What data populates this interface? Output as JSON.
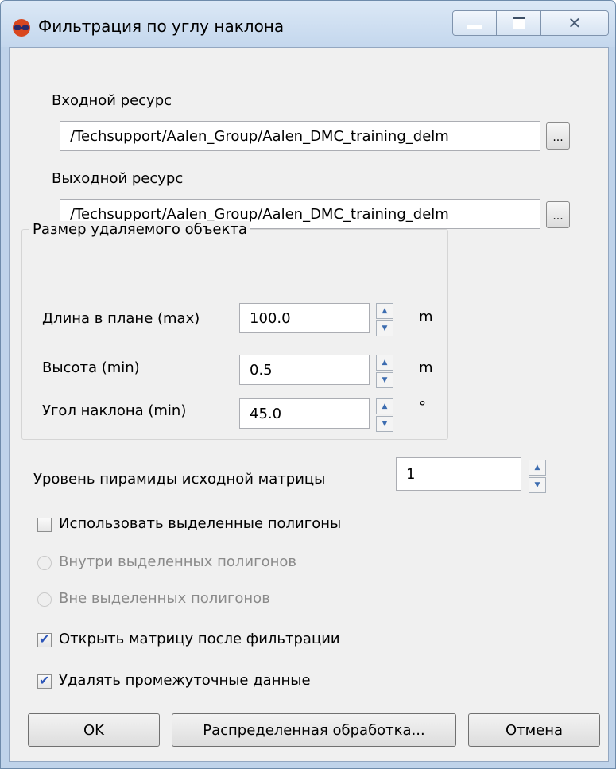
{
  "window": {
    "title": "Фильтрация по углу наклона"
  },
  "titlebar_controls": [
    {
      "name": "minimize-icon",
      "glyph": "—"
    },
    {
      "name": "maximize-icon",
      "glyph": "▣"
    },
    {
      "name": "close-icon",
      "glyph": "✕"
    }
  ],
  "input_resource": {
    "label": "Входной ресурс",
    "value": "/Techsupport/Aalen_Group/Aalen_DMC_training_delm",
    "browse": "..."
  },
  "output_resource": {
    "label": "Выходной ресурс",
    "value": "/Techsupport/Aalen_Group/Aalen_DMC_training_delm",
    "browse": "..."
  },
  "object_size": {
    "title": "Размер удаляемого объекта",
    "fields": [
      {
        "label": "Длина в плане (max)",
        "value": "100.0",
        "unit": "m"
      },
      {
        "label": "Высота (min)",
        "value": "0.5",
        "unit": "m"
      },
      {
        "label": "Угол наклона (min)",
        "value": "45.0",
        "unit": "°"
      }
    ]
  },
  "pyramid": {
    "label": "Уровень пирамиды исходной матрицы",
    "value": "1"
  },
  "options": {
    "use_polygons": {
      "label": "Использовать выделенные полигоны",
      "checked": false
    },
    "inside_polygons": {
      "label": "Внутри выделенных полигонов",
      "enabled": false
    },
    "outside_polygons": {
      "label": "Вне выделенных полигонов",
      "enabled": false
    },
    "open_after": {
      "label": "Открыть матрицу после фильтрации",
      "checked": true
    },
    "delete_temp": {
      "label": "Удалять промежуточные данные",
      "checked": true
    }
  },
  "buttons": {
    "ok": "OK",
    "distributed": "Распределенная обработка...",
    "cancel": "Отмена"
  },
  "colors": {
    "frame": "#bfd3ea",
    "panel": "#f0f0f0",
    "check_accent": "#2c55b8"
  }
}
